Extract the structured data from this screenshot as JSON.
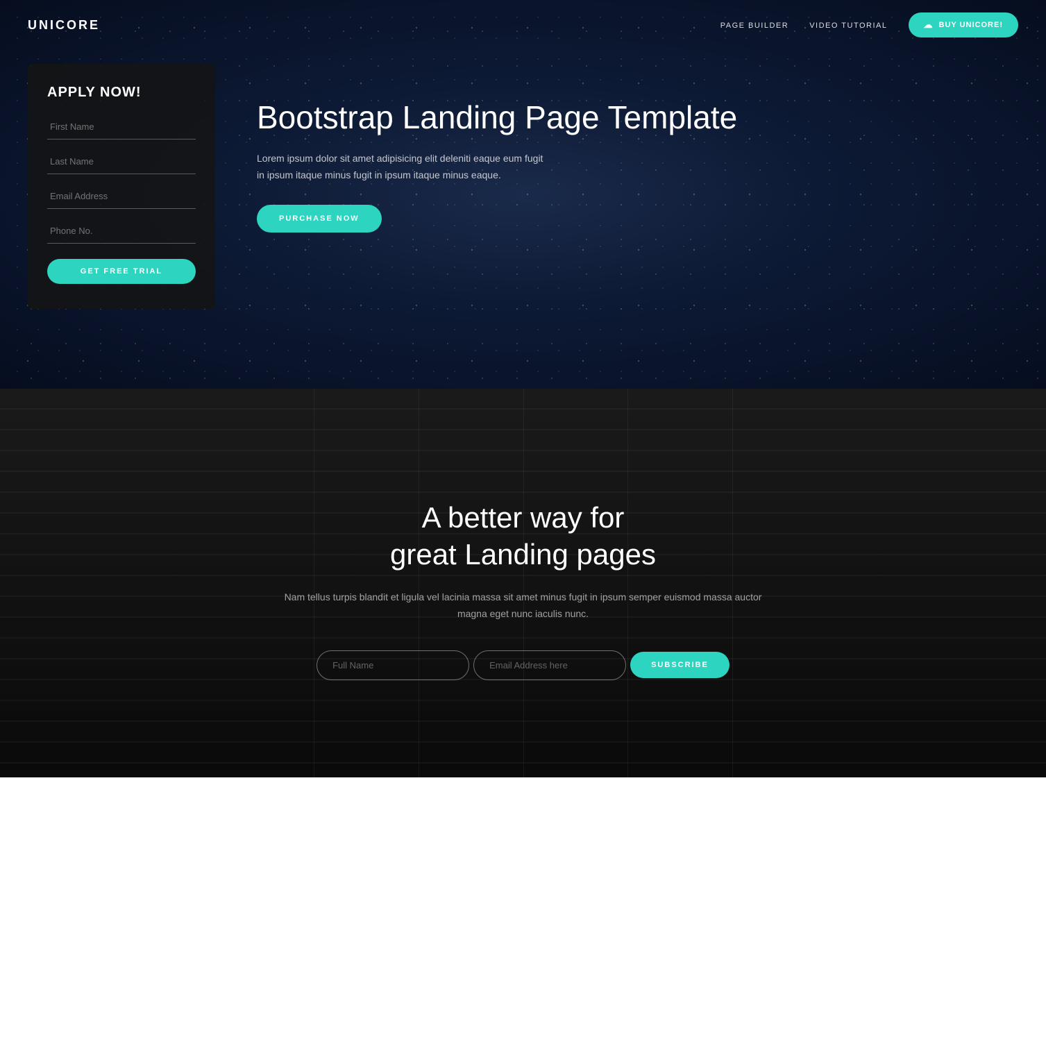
{
  "brand": "UNICORE",
  "nav": {
    "links": [
      {
        "label": "PAGE BUILDER",
        "id": "page-builder"
      },
      {
        "label": "VIDEO TUTORIAL",
        "id": "video-tutorial"
      }
    ],
    "buy_button": "BUY UNICORE!"
  },
  "hero": {
    "heading": "Bootstrap Landing Page Template",
    "description": "Lorem ipsum dolor sit amet adipisicing elit deleniti eaque eum fugit in ipsum itaque minus fugit in ipsum itaque minus eaque.",
    "purchase_button": "PURCHASE NOW"
  },
  "apply_form": {
    "title": "APPLY NOW!",
    "fields": [
      {
        "placeholder": "First Name",
        "id": "first-name"
      },
      {
        "placeholder": "Last Name",
        "id": "last-name"
      },
      {
        "placeholder": "Email Address",
        "id": "email"
      },
      {
        "placeholder": "Phone No.",
        "id": "phone"
      }
    ],
    "submit_button": "GET FREE TRIAL"
  },
  "escalator_section": {
    "heading_line1": "A better way for",
    "heading_line2": "great Landing pages",
    "description": "Nam tellus turpis blandit et ligula vel lacinia massa sit amet minus fugit in ipsum semper euismod massa auctor magna eget nunc iaculis nunc.",
    "full_name_placeholder": "Full Name",
    "email_placeholder": "Email Address here",
    "subscribe_button": "SUBSCRIBE"
  }
}
